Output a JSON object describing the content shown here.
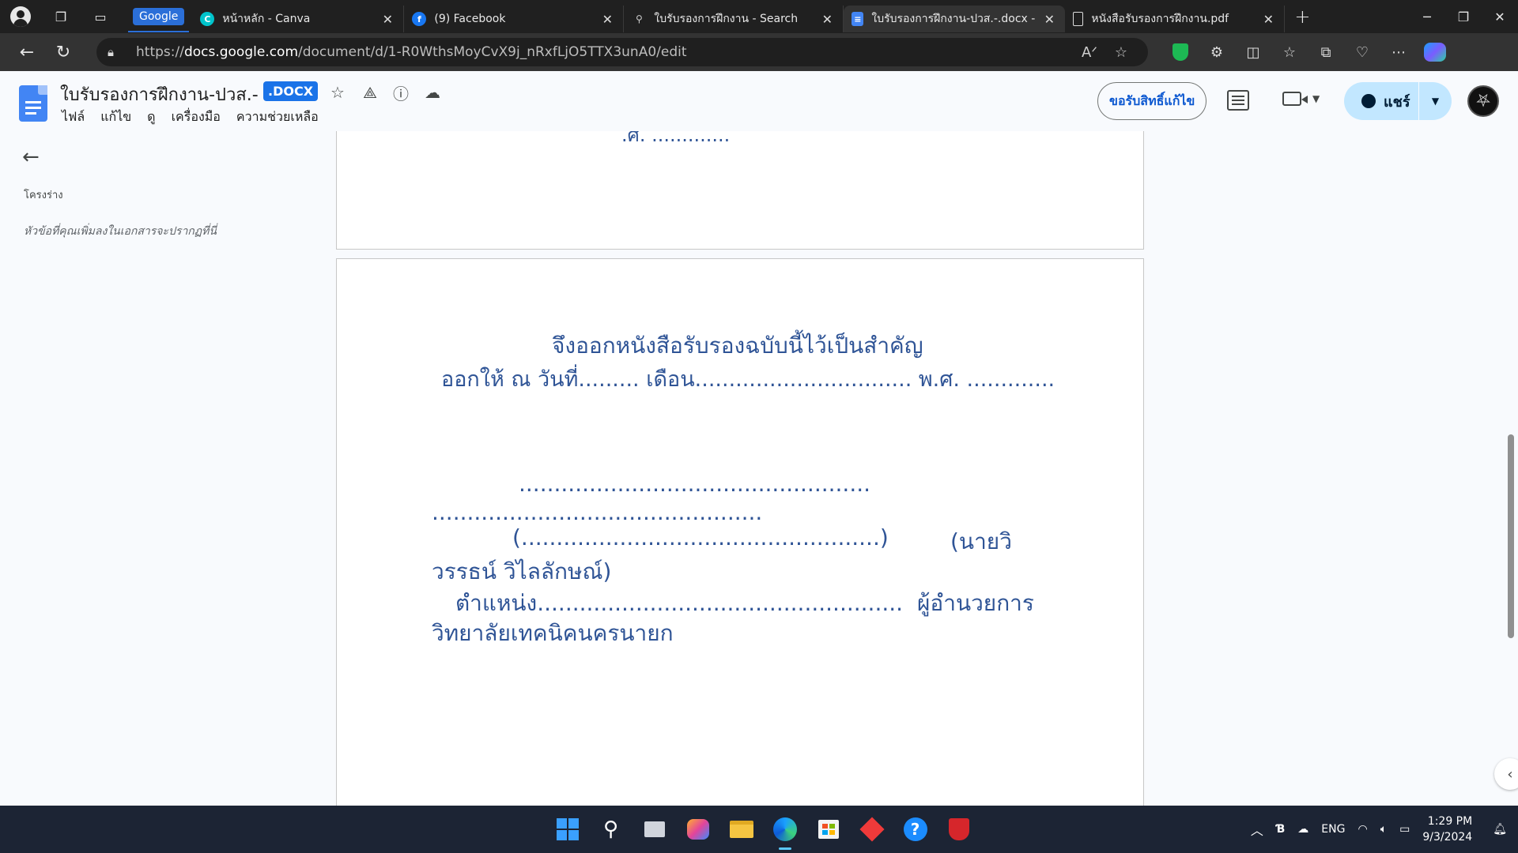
{
  "browser": {
    "tab_group": "Google",
    "tabs": [
      {
        "title": "หน้าหลัก - Canva",
        "icon": "canva-icon",
        "active": false
      },
      {
        "title": "(9) Facebook",
        "icon": "facebook-icon",
        "active": false
      },
      {
        "title": "ใบรับรองการฝึกงาน - Search",
        "icon": "search-icon",
        "active": false
      },
      {
        "title": "ใบรับรองการฝึกงาน-ปวส.-.docx - G",
        "icon": "google-docs-icon",
        "active": true
      },
      {
        "title": "หนังสือรับรองการฝึกงาน.pdf",
        "icon": "file-icon",
        "active": false
      }
    ],
    "url_prefix": "https://",
    "url_host": "docs.google.com",
    "url_path": "/document/d/1-R0WthsMoyCvX9j_nRxfLjO5TTX3unA0/edit"
  },
  "docs": {
    "title": "ใบรับรองการฝึกงาน-ปวส.-",
    "badge": ".DOCX",
    "menu": [
      "ไฟล์",
      "แก้ไข",
      "ดู",
      "เครื่องมือ",
      "ความช่วยเหลือ"
    ],
    "request_edit": "ขอรับสิทธิ์แก้ไข",
    "share": "แชร์"
  },
  "outline": {
    "label": "โครงร่าง",
    "hint": "หัวข้อที่คุณเพิ่มลงในเอกสารจะปรากฏที่นี่"
  },
  "document": {
    "page1_tail": ".ศ. .............",
    "line_issue": "จึงออกหนังสือรับรองฉบับนี้ไว้เป็นสำคัญ",
    "line_date": "ออกให้  ณ  วันที่......... เดือน................................ พ.ศ. .............",
    "sig_dots_1": "..................................................",
    "sig_dots_2": "...............................................",
    "sig_paren": "(...................................................)",
    "sig_name_a": "(นายวิ",
    "sig_name_b": "วรรธน์  วิไลลักษณ์)",
    "position_line": "ตำแหน่ง....................................................",
    "position_title_a": "ผู้อำนวยการ",
    "position_title_b": "วิทยาลัยเทคนิคนครนายก"
  },
  "taskbar": {
    "lang": "ENG",
    "time": "1:29 PM",
    "date": "9/3/2024"
  },
  "colors": {
    "doc_text": "#2f5496",
    "share_bg": "#c2e7ff",
    "docx_badge": "#1a73e8"
  }
}
